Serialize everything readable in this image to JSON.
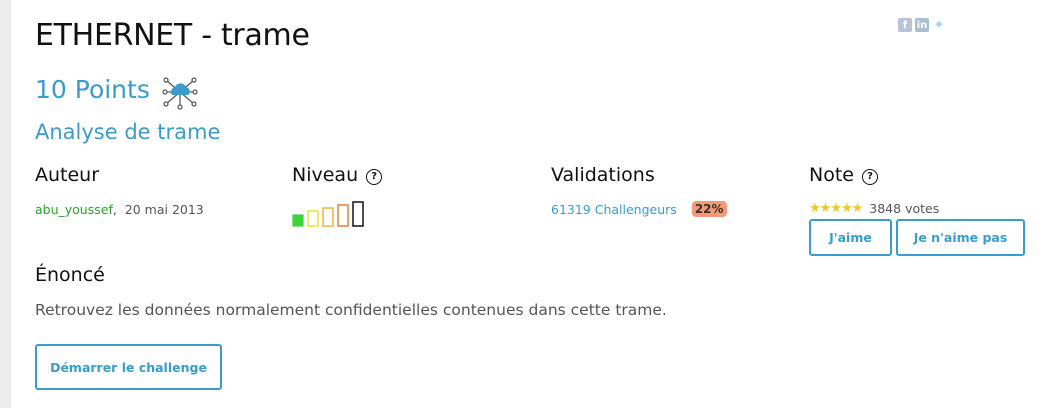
{
  "challenge": {
    "title": "ETHERNET - trame",
    "points": "10 Points",
    "category_icon": "network-cloud-icon",
    "category": "Analyse de trame"
  },
  "social": [
    "facebook-icon",
    "linkedin-icon",
    "twitter-icon"
  ],
  "columns": {
    "author_label": "Auteur",
    "level_label": "Niveau",
    "validations_label": "Validations",
    "note_label": "Note"
  },
  "author": {
    "name": "abu_youssef",
    "date": "20 mai 2013"
  },
  "level": {
    "value": 1,
    "max": 5,
    "colors": [
      "#3bd43b",
      "#f2e22e",
      "#f2b13a",
      "#e67e3a",
      "#c43a2a",
      "#111111"
    ]
  },
  "validations": {
    "count": "61319 Challengeurs",
    "percent": "22%"
  },
  "note": {
    "stars": "★★★★★",
    "votes": "3848 votes",
    "like_label": "J'aime",
    "dislike_label": "Je n'aime pas"
  },
  "statement": {
    "label": "Énoncé",
    "text": "Retrouvez les données normalement confidentielles contenues dans cette trame."
  },
  "start_button": "Démarrer le challenge",
  "accent_color": "#3b9ccc"
}
